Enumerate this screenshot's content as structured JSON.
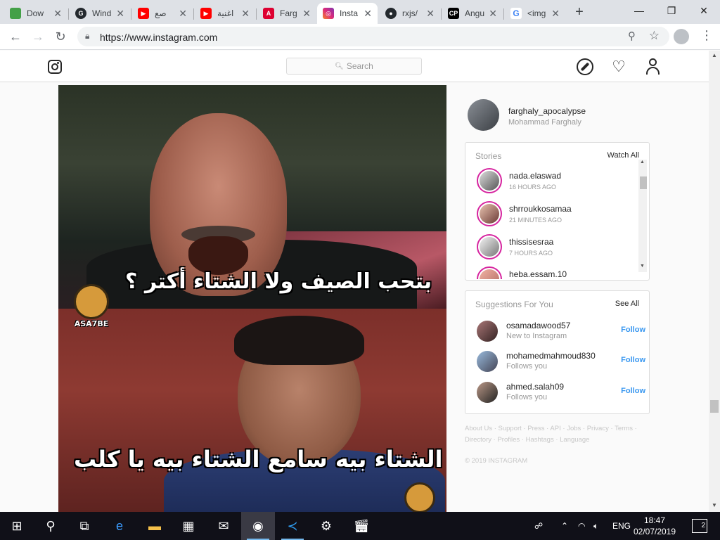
{
  "browser": {
    "tabs": [
      {
        "title": "Dow",
        "icon": "box-icon",
        "color": "#43a047"
      },
      {
        "title": "Wind",
        "icon": "github-logo-icon",
        "color": "#24292e"
      },
      {
        "title": "صع",
        "icon": "youtube-icon",
        "color": "#ff0000"
      },
      {
        "title": "اغنية",
        "icon": "youtube-icon",
        "color": "#ff0000"
      },
      {
        "title": "Farg",
        "icon": "angular-icon",
        "color": "#dd0031"
      },
      {
        "title": "Insta",
        "icon": "instagram-icon",
        "color": "#c13584",
        "active": true
      },
      {
        "title": "rxjs/",
        "icon": "github-icon",
        "color": "#24292e"
      },
      {
        "title": "Angu",
        "icon": "cp-icon",
        "color": "#000000"
      },
      {
        "title": "<img",
        "icon": "google-icon",
        "color": "#4285f4"
      }
    ],
    "url": "https://www.instagram.com"
  },
  "instagram": {
    "search_placeholder": "Search",
    "post": {
      "caption_top": "بتحب الصيف ولا الشتاء أكتر ؟",
      "caption_bottom": "أسمه الشتاء بيه سامع الشتاء بيه يا كلب",
      "badge_label": "ASA7BE"
    },
    "me": {
      "username": "farghaly_apocalypse",
      "fullname": "Mohammad Farghaly"
    },
    "stories": {
      "title": "Stories",
      "action": "Watch All",
      "items": [
        {
          "user": "nada.elaswad",
          "time": "16 HOURS AGO"
        },
        {
          "user": "shrroukkosamaa",
          "time": "21 MINUTES AGO"
        },
        {
          "user": "thissisesraa",
          "time": "7 HOURS AGO"
        },
        {
          "user": "heba.essam.10",
          "time": ""
        }
      ]
    },
    "suggestions": {
      "title": "Suggestions For You",
      "action": "See All",
      "items": [
        {
          "user": "osamadawood57",
          "sub": "New to Instagram",
          "follow": "Follow"
        },
        {
          "user": "mohamedmahmoud830",
          "sub": "Follows you",
          "follow": "Follow"
        },
        {
          "user": "ahmed.salah09",
          "sub": "Follows you",
          "follow": "Follow"
        }
      ]
    },
    "footer": {
      "links": "About Us · Support · Press · API · Jobs · Privacy · Terms · Directory · Profiles · Hashtags · Language",
      "copyright": "© 2019 INSTAGRAM"
    }
  },
  "taskbar": {
    "lang": "ENG",
    "time": "18:47",
    "date": "02/07/2019",
    "notifications": "2"
  }
}
